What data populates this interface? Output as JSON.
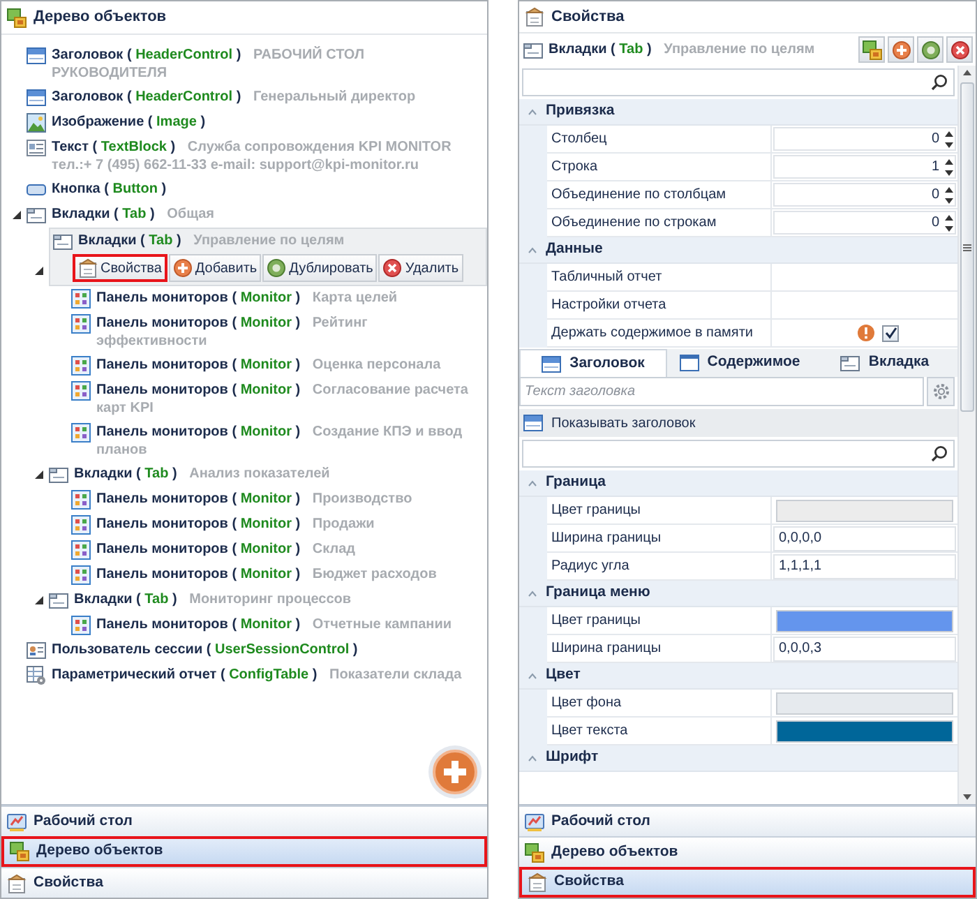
{
  "left_panel": {
    "title": "Дерево объектов",
    "tree": [
      {
        "kind": "header",
        "name": "Заголовок (",
        "type": "HeaderControl",
        "end": ")",
        "caption": "РАБОЧИЙ СТОЛ РУКОВОДИТЕЛЯ",
        "selected": false
      },
      {
        "kind": "header",
        "name": "Заголовок (",
        "type": "HeaderControl",
        "end": ")",
        "caption": "Генеральный  директор",
        "selected": false
      },
      {
        "kind": "image",
        "name": "Изображение (",
        "type": "Image",
        "end": ")",
        "selected": false
      },
      {
        "kind": "text",
        "name": "Текст (",
        "type": "TextBlock",
        "end": ")",
        "caption": "Служба сопровождения KPI MONITOR тел.:+ 7 (495) 662-11-33 e-mail: support@kpi-monitor.ru",
        "selected": false
      },
      {
        "kind": "button",
        "name": "Кнопка (",
        "type": "Button",
        "end": ")",
        "selected": false
      },
      {
        "kind": "tab",
        "name": "Вкладки (",
        "type": "Tab",
        "end": ")",
        "caption": "Общая",
        "selected": false,
        "expanded": true,
        "children": [
          {
            "kind": "tab",
            "name": "Вкладки (",
            "type": "Tab",
            "end": ")",
            "caption": "Управление по целям",
            "selected": true,
            "expanded": true,
            "actions": [
              {
                "kind": "props",
                "label": "Свойства",
                "highlighted": true
              },
              {
                "kind": "add",
                "label": "Добавить",
                "highlighted": false
              },
              {
                "kind": "dup",
                "label": "Дублировать",
                "highlighted": false
              },
              {
                "kind": "delete",
                "label": "Удалить",
                "highlighted": false
              }
            ],
            "children": [
              {
                "kind": "monitor",
                "name": "Панель мониторов (",
                "type": "Monitor",
                "end": ")",
                "caption": "Карта целей",
                "selected": false
              },
              {
                "kind": "monitor",
                "name": "Панель мониторов (",
                "type": "Monitor",
                "end": ")",
                "caption": "Рейтинг эффективности",
                "selected": false
              },
              {
                "kind": "monitor",
                "name": "Панель мониторов (",
                "type": "Monitor",
                "end": ")",
                "caption": "Оценка персонала",
                "selected": false
              },
              {
                "kind": "monitor",
                "name": "Панель мониторов (",
                "type": "Monitor",
                "end": ")",
                "caption": "Согласование расчета карт KPI",
                "selected": false
              },
              {
                "kind": "monitor",
                "name": "Панель мониторов (",
                "type": "Monitor",
                "end": ")",
                "caption": "Создание КПЭ и ввод планов",
                "selected": false
              }
            ]
          },
          {
            "kind": "tab",
            "name": "Вкладки (",
            "type": "Tab",
            "end": ")",
            "caption": "Анализ показателей",
            "selected": false,
            "expanded": true,
            "children": [
              {
                "kind": "monitor",
                "name": "Панель мониторов (",
                "type": "Monitor",
                "end": ")",
                "caption": "Производство",
                "selected": false
              },
              {
                "kind": "monitor",
                "name": "Панель мониторов (",
                "type": "Monitor",
                "end": ")",
                "caption": "Продажи",
                "selected": false
              },
              {
                "kind": "monitor",
                "name": "Панель мониторов (",
                "type": "Monitor",
                "end": ")",
                "caption": "Склад",
                "selected": false
              },
              {
                "kind": "monitor",
                "name": "Панель мониторов (",
                "type": "Monitor",
                "end": ")",
                "caption": "Бюджет расходов",
                "selected": false
              }
            ]
          },
          {
            "kind": "tab",
            "name": "Вкладки (",
            "type": "Tab",
            "end": ")",
            "caption": "Мониторинг процессов",
            "selected": false,
            "expanded": true,
            "children": [
              {
                "kind": "monitor",
                "name": "Панель мониторов (",
                "type": "Monitor",
                "end": ")",
                "caption": "Отчетные кампании",
                "selected": false
              }
            ]
          }
        ]
      },
      {
        "kind": "user",
        "name": "Пользователь сессии (",
        "type": "UserSessionControl",
        "end": ")",
        "selected": false
      },
      {
        "kind": "config",
        "name": "Параметрический отчет (",
        "type": "ConfigTable",
        "end": ")",
        "caption": "Показатели склада",
        "selected": false
      }
    ],
    "nav": [
      {
        "kind": "desktop",
        "label": "Рабочий стол",
        "selected": false
      },
      {
        "kind": "tree",
        "label": "Дерево объектов",
        "selected": true
      },
      {
        "kind": "props",
        "label": "Свойства",
        "selected": false
      }
    ]
  },
  "right_panel": {
    "title": "Свойства",
    "object": {
      "kind": "tab",
      "name": "Вкладки (",
      "type": "Tab",
      "end": ")",
      "caption": "Управление по целям"
    },
    "toolbar": [
      {
        "kind": "tree"
      },
      {
        "kind": "add"
      },
      {
        "kind": "dup"
      },
      {
        "kind": "delete"
      }
    ],
    "grid1": [
      {
        "title": "Привязка",
        "expanded": true,
        "rows": [
          {
            "kind": "spinner",
            "label": "Столбец",
            "value": "0"
          },
          {
            "kind": "spinner",
            "label": "Строка",
            "value": "1"
          },
          {
            "kind": "spinner",
            "label": "Объединение по столбцам",
            "value": "0"
          },
          {
            "kind": "spinner",
            "label": "Объединение по строкам",
            "value": "0"
          }
        ]
      },
      {
        "title": "Данные",
        "expanded": true,
        "rows": [
          {
            "kind": "empty",
            "label": "Табличный отчет"
          },
          {
            "kind": "empty",
            "label": "Настройки отчета"
          },
          {
            "kind": "check",
            "label": "Держать содержимое в памяти",
            "checked": true
          }
        ]
      }
    ],
    "tabs": [
      {
        "kind": "header",
        "label": "Заголовок",
        "selected": true
      },
      {
        "kind": "content",
        "label": "Содержимое",
        "selected": false
      },
      {
        "kind": "tabbar",
        "label": "Вкладка",
        "selected": false
      }
    ],
    "header_text": {
      "placeholder": "Текст заголовка"
    },
    "show_header": {
      "label": "Показывать заголовок"
    },
    "grid2": [
      {
        "title": "Граница",
        "expanded": true,
        "rows": [
          {
            "kind": "color",
            "label": "Цвет границы",
            "color": "#ececec"
          },
          {
            "kind": "text",
            "label": "Ширина границы",
            "value": "0,0,0,0"
          },
          {
            "kind": "text",
            "label": "Радиус угла",
            "value": "1,1,1,1"
          }
        ]
      },
      {
        "title": "Граница меню",
        "expanded": true,
        "rows": [
          {
            "kind": "color",
            "label": "Цвет границы",
            "color": "#6495ed"
          },
          {
            "kind": "text",
            "label": "Ширина границы",
            "value": "0,0,0,3"
          }
        ]
      },
      {
        "title": "Цвет",
        "expanded": true,
        "rows": [
          {
            "kind": "color",
            "label": "Цвет фона",
            "color": "#e6eaee"
          },
          {
            "kind": "color",
            "label": "Цвет текста",
            "color": "#006699"
          }
        ]
      },
      {
        "title": "Шрифт",
        "expanded": true
      }
    ],
    "nav": [
      {
        "kind": "desktop",
        "label": "Рабочий стол",
        "selected": false
      },
      {
        "kind": "tree",
        "label": "Дерево объектов",
        "selected": false
      },
      {
        "kind": "props",
        "label": "Свойства",
        "selected": true
      }
    ]
  }
}
